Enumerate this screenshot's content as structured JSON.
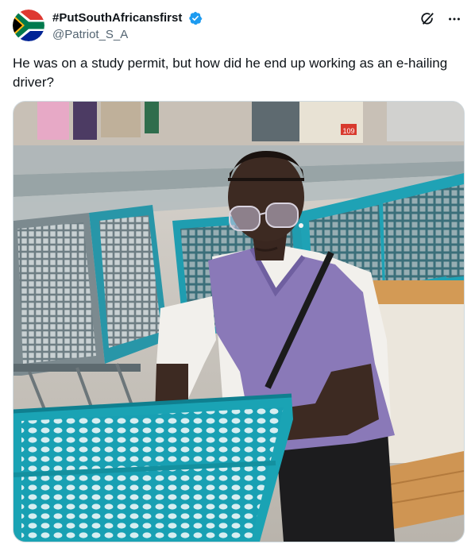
{
  "tweet": {
    "display_name": "#PutSouthAfricansfirst",
    "handle": "@Patriot_S_A",
    "text": "He was on a study permit, but how did he end up working as an e-hailing driver?",
    "avatar_icon": "south-africa-flag-icon",
    "verified_icon": "verified-badge-icon",
    "grok_icon": "grok-icon",
    "more_icon": "more-options-icon"
  },
  "colors": {
    "verified": "#1d9bf0",
    "text": "#0f1419",
    "secondary_text": "#536471",
    "cart_teal": "#1aa3b4",
    "vest_purple": "#8a79b8"
  },
  "media": {
    "sign_price": "109"
  }
}
